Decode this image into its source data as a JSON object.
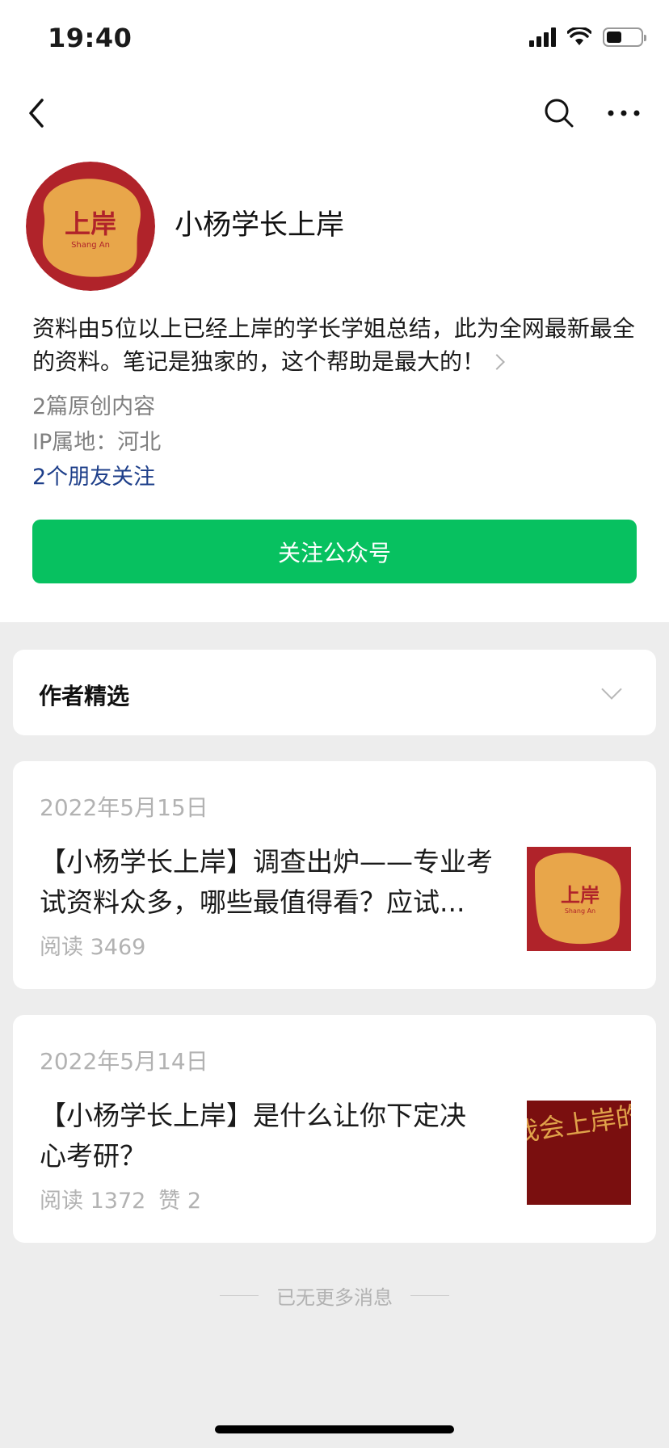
{
  "status_bar": {
    "time": "19:40"
  },
  "nav": {
    "back_icon": "chevron-left-icon",
    "search_icon": "search-icon",
    "more_icon": "more-dots-icon"
  },
  "account": {
    "avatar_text": "上岸",
    "avatar_subtext": "Shang An",
    "name": "小杨学长上岸",
    "description": "资料由5位以上已经上岸的学长学姐总结，此为全网最新最全的资料。笔记是独家的，这个帮助是最大的！",
    "original_count": "2篇原创内容",
    "ip_location": "IP属地：河北",
    "friends_following": "2个朋友关注",
    "follow_button": "关注公众号"
  },
  "featured": {
    "title": "作者精选"
  },
  "articles": [
    {
      "date": "2022年5月15日",
      "title": "【小杨学长上岸】调查出炉——专业考试资料众多，哪些最值得看？应试...",
      "reads": "阅读 3469",
      "likes": "",
      "thumb_text": "上岸",
      "thumb_subtext": "Shang An"
    },
    {
      "date": "2022年5月14日",
      "title": "【小杨学长上岸】是什么让你下定决心考研？",
      "reads": "阅读 1372",
      "likes": "赞 2",
      "thumb_text": "我会上岸的"
    }
  ],
  "footer": {
    "end_text": "已无更多消息"
  },
  "colors": {
    "primary_green": "#07c160",
    "link_blue": "#1e3f8a",
    "avatar_red": "#b0232a",
    "avatar_gold": "#e8a64a"
  }
}
